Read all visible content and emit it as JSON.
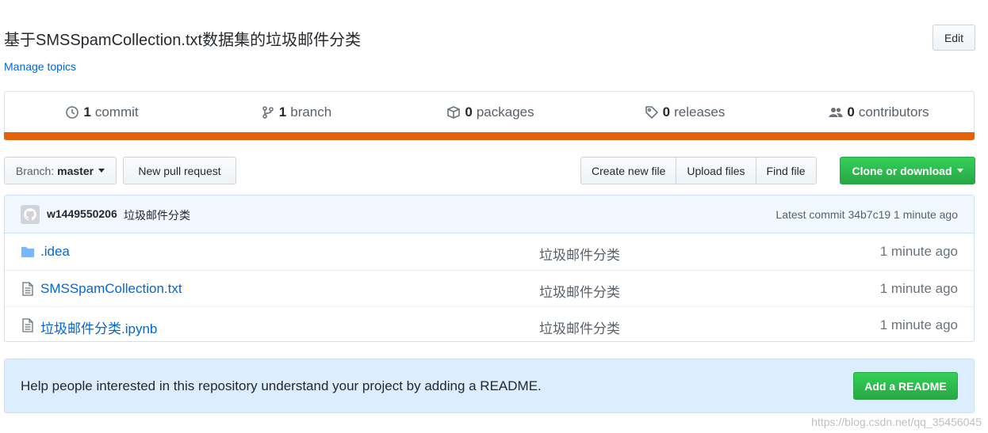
{
  "repo": {
    "description": "基于SMSSpamCollection.txt数据集的垃圾邮件分类",
    "manage_topics": "Manage topics",
    "edit_label": "Edit"
  },
  "summary": {
    "commits": {
      "count": "1",
      "label": "commit",
      "icon": "history-icon"
    },
    "branches": {
      "count": "1",
      "label": "branch",
      "icon": "git-branch-icon"
    },
    "packages": {
      "count": "0",
      "label": "packages",
      "icon": "package-icon"
    },
    "releases": {
      "count": "0",
      "label": "releases",
      "icon": "tag-icon"
    },
    "contributors": {
      "count": "0",
      "label": "contributors",
      "icon": "people-icon"
    }
  },
  "language_bar_color": "#e36209",
  "toolbar": {
    "branch_label": "Branch:",
    "branch_value": "master",
    "new_pull_request": "New pull request",
    "create_new_file": "Create new file",
    "upload_files": "Upload files",
    "find_file": "Find file",
    "clone_or_download": "Clone or download"
  },
  "latest_commit": {
    "author": "w1449550206",
    "message": "垃圾邮件分类",
    "label": "Latest commit",
    "sha": "34b7c19",
    "age": "1 minute ago"
  },
  "files": [
    {
      "name": ".idea",
      "type": "folder",
      "message": "垃圾邮件分类",
      "age": "1 minute ago"
    },
    {
      "name": "SMSSpamCollection.txt",
      "type": "file",
      "message": "垃圾邮件分类",
      "age": "1 minute ago"
    },
    {
      "name": "垃圾邮件分类.ipynb",
      "type": "file",
      "message": "垃圾邮件分类",
      "age": "1 minute ago"
    }
  ],
  "readme": {
    "prompt": "Help people interested in this repository understand your project by adding a README.",
    "button": "Add a README"
  },
  "watermark": "https://blog.csdn.net/qq_35456045",
  "colors": {
    "accent_green": "#28a745",
    "link_blue": "#0366d6",
    "readme_bg": "#dbedff"
  }
}
